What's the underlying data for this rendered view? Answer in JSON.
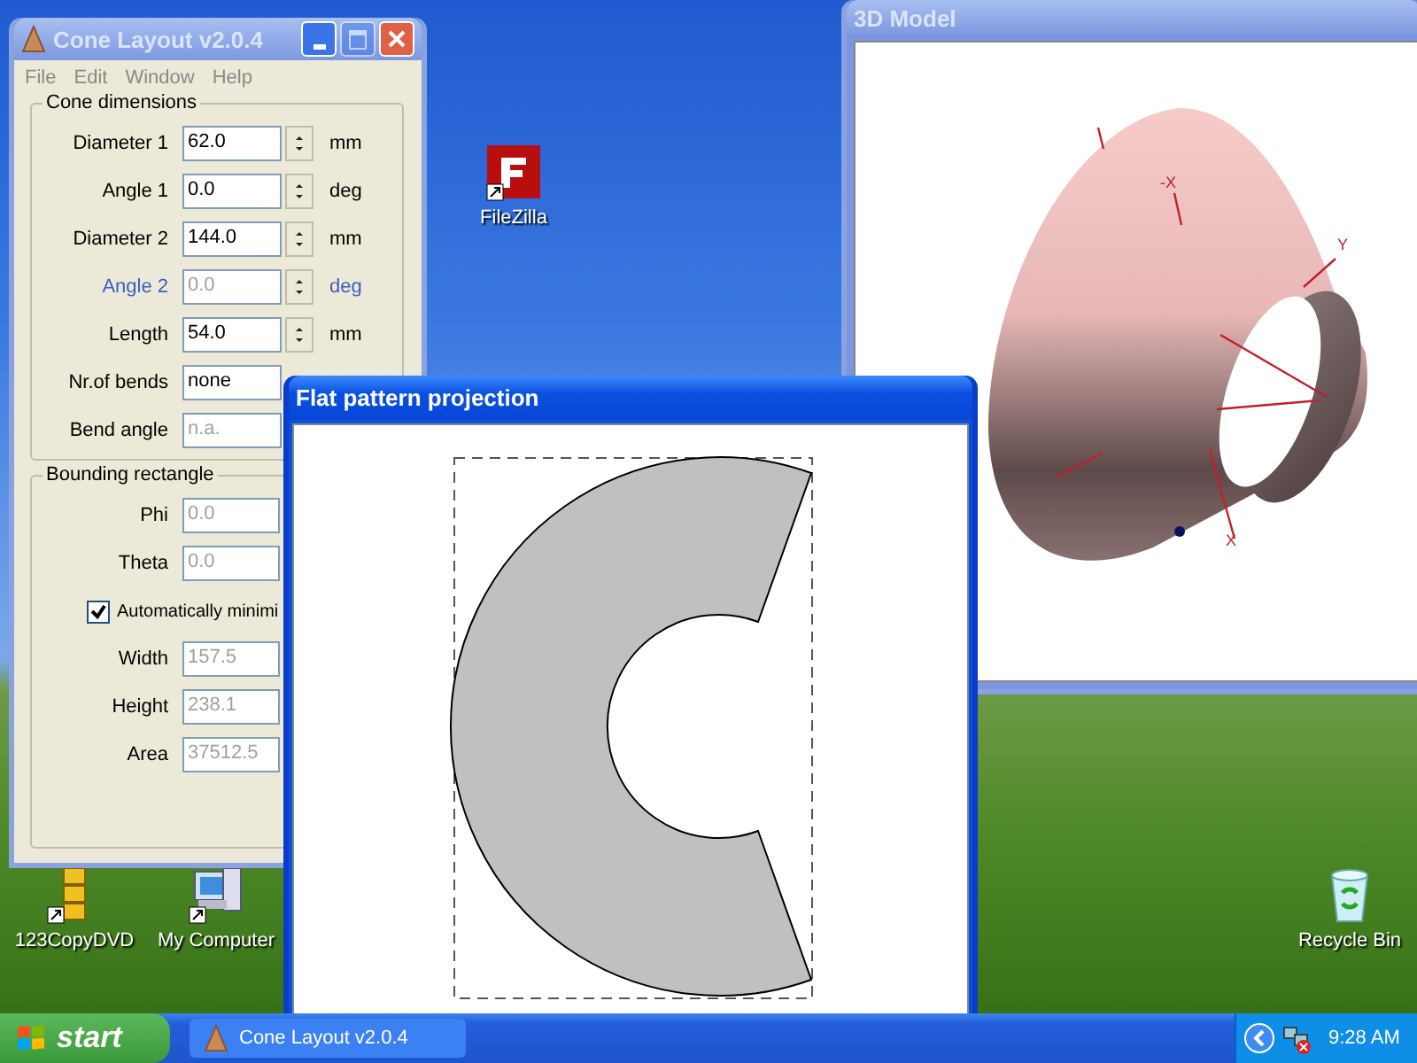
{
  "desktop": {
    "icons": [
      {
        "kind": "ftp",
        "label": "FileZilla"
      },
      {
        "kind": "blocks",
        "label": "123CopyDVD"
      },
      {
        "kind": "computer",
        "label": "My Computer"
      },
      {
        "kind": "bin",
        "label": "Recycle Bin"
      }
    ]
  },
  "main_window": {
    "title": "Cone Layout v2.0.4",
    "active": false,
    "menu": [
      "File",
      "Edit",
      "Window",
      "Help"
    ],
    "cone_dimensions": {
      "title": "Cone dimensions",
      "rows": [
        {
          "label": "Diameter 1",
          "value": "62.0",
          "unit": "mm",
          "spinner": true,
          "highlighted": false,
          "disabled": false
        },
        {
          "label": "Angle 1",
          "value": "0.0",
          "unit": "deg",
          "spinner": true,
          "highlighted": false,
          "disabled": false
        },
        {
          "label": "Diameter 2",
          "value": "144.0",
          "unit": "mm",
          "spinner": true,
          "highlighted": false,
          "disabled": false
        },
        {
          "label": "Angle 2",
          "value": "0.0",
          "unit": "deg",
          "spinner": true,
          "highlighted": true,
          "disabled": true
        },
        {
          "label": "Length",
          "value": "54.0",
          "unit": "mm",
          "spinner": true,
          "highlighted": false,
          "disabled": false
        },
        {
          "label": "Nr.of bends",
          "value": "none",
          "highlighted": false,
          "disabled": false
        },
        {
          "label": "Bend angle",
          "value": "n.a.",
          "highlighted": false,
          "disabled": true
        }
      ]
    },
    "bounding_rectangle": {
      "title": "Bounding rectangle",
      "rows": [
        {
          "kind": "field",
          "label": "Phi",
          "value": "0.0",
          "disabled": true
        },
        {
          "kind": "field",
          "label": "Theta",
          "value": "0.0",
          "disabled": true
        },
        {
          "kind": "checkbox",
          "label": "Automatically minimi",
          "checked": true
        },
        {
          "kind": "field",
          "label": "Width",
          "value": "157.5",
          "disabled": true
        },
        {
          "kind": "field",
          "label": "Height",
          "value": "238.1",
          "disabled": true
        },
        {
          "kind": "field",
          "label": "Area",
          "value": "37512.5",
          "disabled": true
        }
      ]
    }
  },
  "model_window": {
    "title": "3D Model",
    "active": false,
    "axis_labels": [
      "-X",
      "Y",
      "X"
    ]
  },
  "pattern_window": {
    "title": "Flat pattern projection",
    "active": true
  },
  "taskbar": {
    "start": "start",
    "tasks": [
      {
        "label": "Cone Layout v2.0.4",
        "selected": false
      }
    ],
    "clock": "9:28 AM"
  }
}
